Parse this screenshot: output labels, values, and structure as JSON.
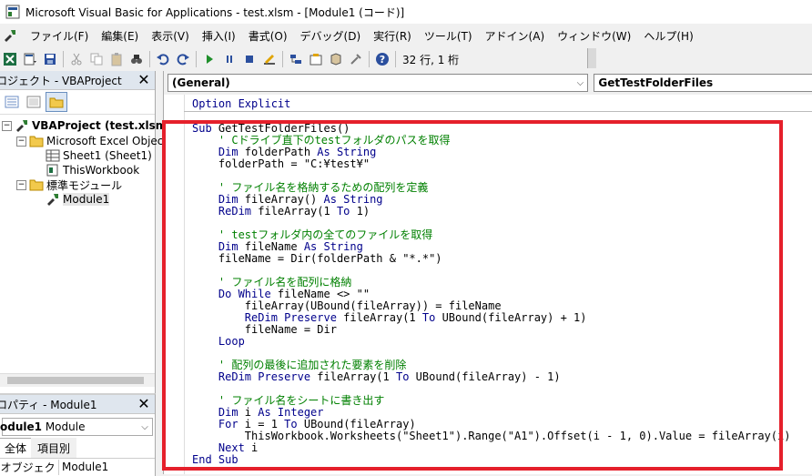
{
  "window": {
    "title": "Microsoft Visual Basic for Applications - test.xlsm - [Module1 (コード)]"
  },
  "menu": [
    "ファイル(F)",
    "編集(E)",
    "表示(V)",
    "挿入(I)",
    "書式(O)",
    "デバッグ(D)",
    "実行(R)",
    "ツール(T)",
    "アドイン(A)",
    "ウィンドウ(W)",
    "ヘルプ(H)"
  ],
  "toolbar": {
    "cursor_position": "32 行, 1 桁"
  },
  "project_explorer": {
    "title": "ロジェクト - VBAProject",
    "close": "✕",
    "tree": {
      "root": "VBAProject (test.xlsm",
      "excel_objects": "Microsoft Excel Object",
      "sheet1": "Sheet1 (Sheet1)",
      "thisworkbook": "ThisWorkbook",
      "std_module": "標準モジュール",
      "module1": "Module1"
    }
  },
  "properties": {
    "title": "ロパティ - Module1",
    "close": "✕",
    "object_bold": "odule1",
    "object_type": "Module",
    "tab_all": "全体",
    "tab_category": "項目別",
    "row_key": "(オブジェクト名)",
    "row_value": "Module1"
  },
  "code_window": {
    "object_combo": "(General)",
    "proc_combo": "GetTestFolderFiles",
    "option_line": "Option Explicit",
    "lines": [
      [
        {
          "t": "Sub ",
          "c": "kw"
        },
        {
          "t": "GetTestFolderFiles()",
          "c": ""
        }
      ],
      [
        {
          "t": "    ' Cドライブ直下のtestフォルダのパスを取得",
          "c": "cm"
        }
      ],
      [
        {
          "t": "    Dim ",
          "c": "kw"
        },
        {
          "t": "folderPath ",
          "c": ""
        },
        {
          "t": "As String",
          "c": "kw"
        }
      ],
      [
        {
          "t": "    folderPath = \"C:¥test¥\"",
          "c": ""
        }
      ],
      [
        {
          "t": "",
          "c": ""
        }
      ],
      [
        {
          "t": "    ' ファイル名を格納するための配列を定義",
          "c": "cm"
        }
      ],
      [
        {
          "t": "    Dim ",
          "c": "kw"
        },
        {
          "t": "fileArray() ",
          "c": ""
        },
        {
          "t": "As String",
          "c": "kw"
        }
      ],
      [
        {
          "t": "    ReDim ",
          "c": "kw"
        },
        {
          "t": "fileArray(1 ",
          "c": ""
        },
        {
          "t": "To ",
          "c": "kw"
        },
        {
          "t": "1)",
          "c": ""
        }
      ],
      [
        {
          "t": "",
          "c": ""
        }
      ],
      [
        {
          "t": "    ' testフォルダ内の全てのファイルを取得",
          "c": "cm"
        }
      ],
      [
        {
          "t": "    Dim ",
          "c": "kw"
        },
        {
          "t": "fileName ",
          "c": ""
        },
        {
          "t": "As String",
          "c": "kw"
        }
      ],
      [
        {
          "t": "    fileName = Dir(folderPath & \"*.*\")",
          "c": ""
        }
      ],
      [
        {
          "t": "",
          "c": ""
        }
      ],
      [
        {
          "t": "    ' ファイル名を配列に格納",
          "c": "cm"
        }
      ],
      [
        {
          "t": "    Do While ",
          "c": "kw"
        },
        {
          "t": "fileName <> \"\"",
          "c": ""
        }
      ],
      [
        {
          "t": "        fileArray(UBound(fileArray)) = fileName",
          "c": ""
        }
      ],
      [
        {
          "t": "        ReDim Preserve ",
          "c": "kw"
        },
        {
          "t": "fileArray(1 ",
          "c": ""
        },
        {
          "t": "To ",
          "c": "kw"
        },
        {
          "t": "UBound(fileArray) + 1)",
          "c": ""
        }
      ],
      [
        {
          "t": "        fileName = Dir",
          "c": ""
        }
      ],
      [
        {
          "t": "    Loop",
          "c": "kw"
        }
      ],
      [
        {
          "t": "",
          "c": ""
        }
      ],
      [
        {
          "t": "    ' 配列の最後に追加された要素を削除",
          "c": "cm"
        }
      ],
      [
        {
          "t": "    ReDim Preserve ",
          "c": "kw"
        },
        {
          "t": "fileArray(1 ",
          "c": ""
        },
        {
          "t": "To ",
          "c": "kw"
        },
        {
          "t": "UBound(fileArray) - 1)",
          "c": ""
        }
      ],
      [
        {
          "t": "",
          "c": ""
        }
      ],
      [
        {
          "t": "    ' ファイル名をシートに書き出す",
          "c": "cm"
        }
      ],
      [
        {
          "t": "    Dim ",
          "c": "kw"
        },
        {
          "t": "i ",
          "c": ""
        },
        {
          "t": "As Integer",
          "c": "kw"
        }
      ],
      [
        {
          "t": "    For ",
          "c": "kw"
        },
        {
          "t": "i = 1 ",
          "c": ""
        },
        {
          "t": "To ",
          "c": "kw"
        },
        {
          "t": "UBound(fileArray)",
          "c": ""
        }
      ],
      [
        {
          "t": "        ThisWorkbook.Worksheets(\"Sheet1\").Range(\"A1\").Offset(i - 1, 0).Value = fileArray(i)",
          "c": ""
        }
      ],
      [
        {
          "t": "    Next ",
          "c": "kw"
        },
        {
          "t": "i",
          "c": ""
        }
      ],
      [
        {
          "t": "End Sub",
          "c": "kw"
        }
      ]
    ]
  },
  "colors": {
    "highlight_border": "#e5202b",
    "keyword": "#00008b",
    "comment": "#008000"
  }
}
